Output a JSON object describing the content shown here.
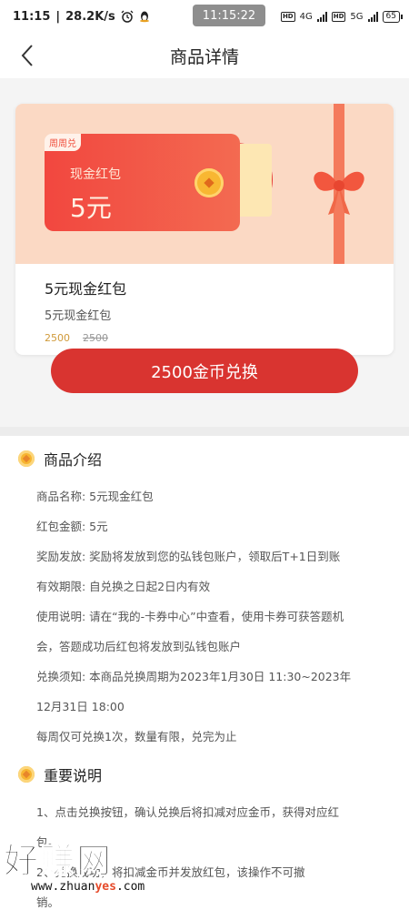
{
  "status": {
    "time": "11:15",
    "speed": "28.2K/s",
    "center_time": "11:15:22",
    "net1": "4G",
    "net2": "5G",
    "battery": "65"
  },
  "header": {
    "title": "商品详情"
  },
  "product": {
    "tag": "周周兑",
    "banner_label": "现金红包",
    "banner_amount": "5元",
    "name": "5元现金红包",
    "subtitle": "5元现金红包",
    "price": "2500",
    "original_price": "2500"
  },
  "exchange_button": "2500金币兑换",
  "intro": {
    "title": "商品介绍",
    "lines": [
      "商品名称: 5元现金红包",
      "红包金额: 5元",
      "奖励发放: 奖励将发放到您的弘钱包账户，领取后T+1日到账",
      "有效期限: 自兑换之日起2日内有效",
      "使用说明: 请在“我的-卡券中心”中查看，使用卡券可获答题机",
      "会，答题成功后红包将发放到弘钱包账户",
      "兑换须知: 本商品兑换周期为2023年1月30日 11:30~2023年",
      "12月31日 18:00",
      "每周仅可兑换1次，数量有限，兑完为止"
    ]
  },
  "notes": {
    "title": "重要说明",
    "lines": [
      "1、点击兑换按钮，确认兑换后将扣减对应金币，获得对应红",
      "包。",
      "2、兑换成功，将扣减金币并发放红包，该操作不可撤",
      "销。"
    ]
  },
  "watermark": {
    "big": "好赚网",
    "small_prefix": "www.zhuan",
    "small_accent": "yes",
    "small_suffix": ".com"
  }
}
